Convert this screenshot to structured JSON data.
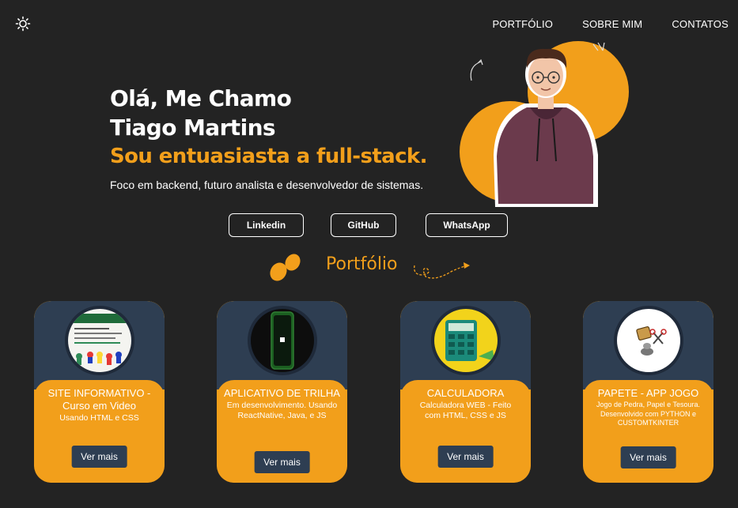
{
  "nav": {
    "theme_icon": "sun-icon",
    "links": [
      "PORTFÓLIO",
      "SOBRE MIM",
      "CONTATOS"
    ]
  },
  "hero": {
    "line1": "Olá, Me Chamo",
    "line2": "Tiago Martins",
    "accent": "Sou entuasiasta a full-stack.",
    "subtitle": "Foco em backend, futuro analista e desenvolvedor de sistemas."
  },
  "socials": [
    "Linkedin",
    "GitHub",
    "WhatsApp"
  ],
  "section": {
    "title": "Portfólio"
  },
  "projects": [
    {
      "title": "SITE INFORMATIVO - Curso em Video",
      "desc": "Usando HTML e CSS",
      "button": "Ver mais"
    },
    {
      "title": "APLICATIVO DE TRILHA",
      "desc": "Em desenvolvimento. Usando ReactNative, Java, e JS",
      "button": "Ver mais"
    },
    {
      "title": "CALCULADORA",
      "desc": "Calculadora WEB - Feito com HTML, CSS e JS",
      "button": "Ver mais"
    },
    {
      "title": "PAPETE - APP JOGO",
      "desc": "Jogo de Pedra, Papel e Tesoura. Desenvolvido com PYTHON e CUSTOMTKINTER",
      "button": "Ver mais"
    }
  ],
  "colors": {
    "background": "#232323",
    "accent": "#f29f1b",
    "card_dark": "#2e3e52"
  }
}
